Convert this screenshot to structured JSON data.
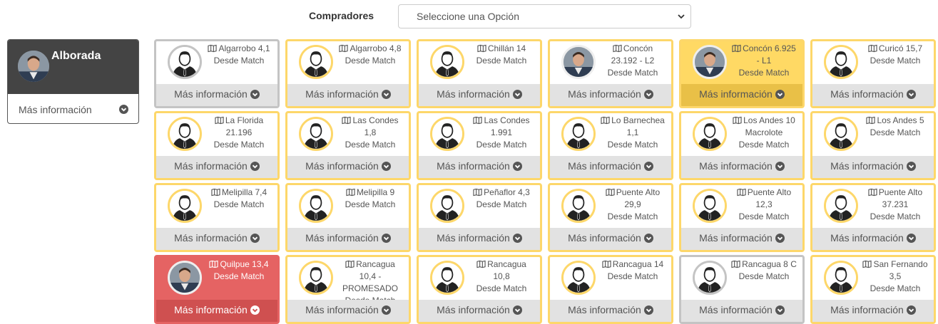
{
  "filter": {
    "label": "Compradores",
    "selected": "Seleccione una Opción"
  },
  "owner": {
    "name": "Alboradа",
    "more_label": "Más información"
  },
  "cards": [
    {
      "lines": [
        "Algarrobo 4,1"
      ],
      "sub": "Desde Match",
      "variant": "gray",
      "avatar": "user-silhouette",
      "avatar_border": "gray",
      "more": "Más información"
    },
    {
      "lines": [
        "Algarrobo 4,8"
      ],
      "sub": "Desde Match",
      "variant": "",
      "avatar": "user-silhouette",
      "avatar_border": "",
      "more": "Más información"
    },
    {
      "lines": [
        "Chillán 14"
      ],
      "sub": "Desde Match",
      "variant": "",
      "avatar": "user-silhouette",
      "avatar_border": "",
      "more": "Más información"
    },
    {
      "lines": [
        "Concón",
        "23.192 - L2"
      ],
      "sub": "Desde Match",
      "variant": "",
      "avatar": "user-photo",
      "avatar_border": "photo",
      "more": "Más información"
    },
    {
      "lines": [
        "Concón 6.925",
        "- L1"
      ],
      "sub": "Desde Match",
      "variant": "gold",
      "avatar": "user-photo",
      "avatar_border": "photo",
      "more": "Más información"
    },
    {
      "lines": [
        "Curicó 15,7"
      ],
      "sub": "Desde Match",
      "variant": "",
      "avatar": "user-silhouette",
      "avatar_border": "",
      "more": "Más información"
    },
    {
      "lines": [
        "La Florida",
        "21.196"
      ],
      "sub": "Desde Match",
      "variant": "",
      "avatar": "user-silhouette",
      "avatar_border": "",
      "more": "Más información"
    },
    {
      "lines": [
        "Las Condes",
        "1,8"
      ],
      "sub": "Desde Match",
      "variant": "",
      "avatar": "user-silhouette",
      "avatar_border": "",
      "more": "Más información"
    },
    {
      "lines": [
        "Las Condes",
        "1.991"
      ],
      "sub": "Desde Match",
      "variant": "",
      "avatar": "user-silhouette",
      "avatar_border": "",
      "more": "Más información"
    },
    {
      "lines": [
        "Lo Barnechea",
        "1,1"
      ],
      "sub": "Desde Match",
      "variant": "",
      "avatar": "user-silhouette",
      "avatar_border": "",
      "more": "Más información"
    },
    {
      "lines": [
        "Los Andes 10",
        "Macrolote"
      ],
      "sub": "Desde Match",
      "variant": "",
      "avatar": "user-silhouette",
      "avatar_border": "",
      "more": "Más información"
    },
    {
      "lines": [
        "Los Andes 5"
      ],
      "sub": "Desde Match",
      "variant": "",
      "avatar": "user-silhouette",
      "avatar_border": "",
      "more": "Más información"
    },
    {
      "lines": [
        "Melipilla 7,4"
      ],
      "sub": "Desde Match",
      "variant": "",
      "avatar": "user-silhouette",
      "avatar_border": "",
      "more": "Más información"
    },
    {
      "lines": [
        "Melipilla 9"
      ],
      "sub": "Desde Match",
      "variant": "",
      "avatar": "user-silhouette",
      "avatar_border": "",
      "more": "Más información"
    },
    {
      "lines": [
        "Peñaflor 4,3"
      ],
      "sub": "Desde Match",
      "variant": "",
      "avatar": "user-silhouette",
      "avatar_border": "",
      "more": "Más información"
    },
    {
      "lines": [
        "Puente Alto",
        "29,9"
      ],
      "sub": "Desde Match",
      "variant": "",
      "avatar": "user-silhouette",
      "avatar_border": "",
      "more": "Más información"
    },
    {
      "lines": [
        "Puente Alto",
        "12,3"
      ],
      "sub": "Desde Match",
      "variant": "",
      "avatar": "user-silhouette",
      "avatar_border": "",
      "more": "Más información"
    },
    {
      "lines": [
        "Puente Alto",
        "37.231"
      ],
      "sub": "Desde Match",
      "variant": "",
      "avatar": "user-silhouette",
      "avatar_border": "",
      "more": "Más información"
    },
    {
      "lines": [
        "Quilpue 13,4"
      ],
      "sub": "Desde Match",
      "variant": "red",
      "avatar": "user-photo",
      "avatar_border": "photo",
      "more": "Más información"
    },
    {
      "lines": [
        "Rancagua",
        "10,4 -",
        "PROMESADO"
      ],
      "sub": "Desde Match",
      "variant": "",
      "avatar": "user-silhouette",
      "avatar_border": "",
      "more": "Más información"
    },
    {
      "lines": [
        "Rancagua",
        "10,8"
      ],
      "sub": "Desde Match",
      "variant": "",
      "avatar": "user-silhouette",
      "avatar_border": "",
      "more": "Más información"
    },
    {
      "lines": [
        "Rancagua 14"
      ],
      "sub": "Desde Match",
      "variant": "",
      "avatar": "user-silhouette",
      "avatar_border": "",
      "more": "Más información"
    },
    {
      "lines": [
        "Rancagua 8 C"
      ],
      "sub": "Desde Match",
      "variant": "gray",
      "avatar": "user-silhouette",
      "avatar_border": "gray",
      "more": "Más información"
    },
    {
      "lines": [
        "San Fernando",
        "3,5"
      ],
      "sub": "Desde Match",
      "variant": "",
      "avatar": "user-silhouette",
      "avatar_border": "",
      "more": "Más información"
    }
  ]
}
